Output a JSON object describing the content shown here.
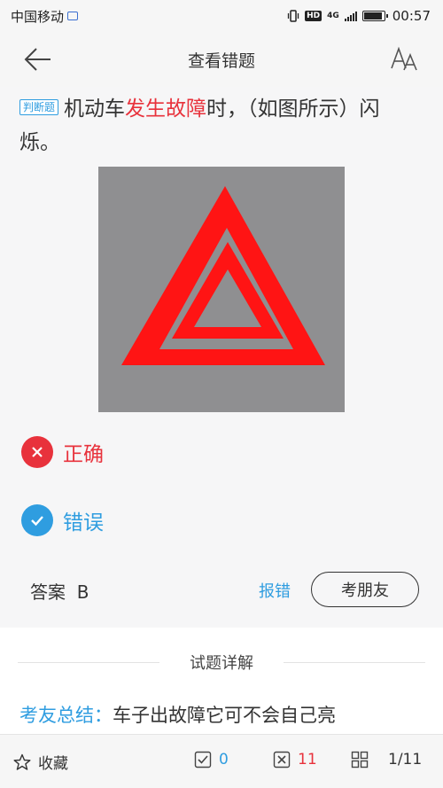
{
  "status_bar": {
    "carrier": "中国移动",
    "network": "HD",
    "signal": "4G",
    "time": "00:57",
    "battery_level": 0.85
  },
  "nav": {
    "title": "查看错题",
    "back_icon": "arrow-left-icon",
    "font_icon": "font-size-icon"
  },
  "question": {
    "tag": "判断题",
    "text_before": "机动车",
    "text_highlight": "发生故障",
    "text_after": "时，（如图所示）闪烁。",
    "image": "hazard-warning-triangle"
  },
  "options": [
    {
      "label": "正确",
      "state": "wrong",
      "color": "#e8323c"
    },
    {
      "label": "错误",
      "state": "correct",
      "color": "#2f9de0"
    }
  ],
  "answer": {
    "text": "答案  B",
    "report_label": "报错",
    "friend_button_label": "考朋友"
  },
  "detail": {
    "title": "试题详解",
    "summary_label": "考友总结：",
    "summary_text": "车子出故障它可不会自己亮"
  },
  "bottom_bar": {
    "favorite_label": "收藏",
    "correct_count": "0",
    "wrong_count": "11",
    "progress": "1/11"
  },
  "colors": {
    "accent": "#2f9de0",
    "error": "#e8323c",
    "background": "#f6f6f7"
  }
}
